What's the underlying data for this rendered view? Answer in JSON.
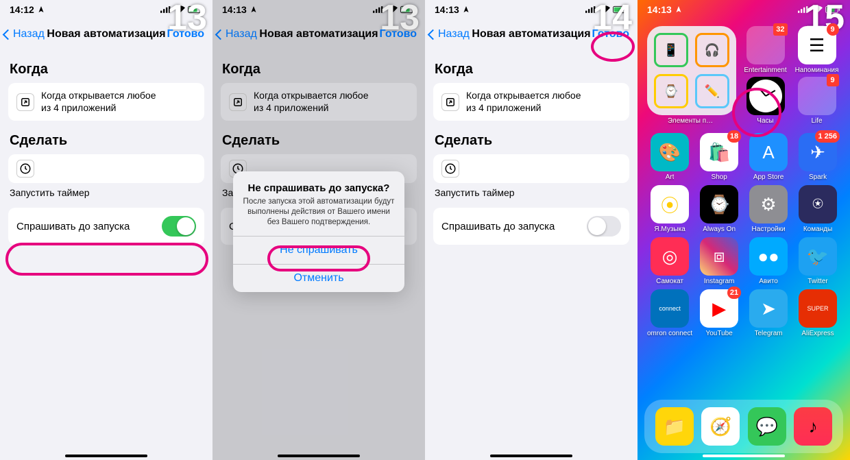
{
  "steps": [
    "13",
    "14",
    "15"
  ],
  "status": {
    "time": "14:12",
    "time_alt": "14:13"
  },
  "nav": {
    "back": "Назад",
    "title": "Новая автоматизация",
    "done": "Готово"
  },
  "when": {
    "header": "Когда",
    "card_line1": "Когда открывается любое",
    "card_line2": "из 4 приложений"
  },
  "do": {
    "header": "Сделать",
    "action": "Запустить таймер"
  },
  "toggle": {
    "label": "Спрашивать до запуска"
  },
  "alert": {
    "title": "Не спрашивать до запуска?",
    "msg": "После запуска этой автоматизации будут выполнены действия от Вашего имени без Вашего подтверждения.",
    "confirm": "Не спрашивать",
    "cancel": "Отменить"
  },
  "home": {
    "widget_label": "Элементы питания",
    "row1": [
      {
        "label": "Часы",
        "bg": "#000",
        "badge": "",
        "kind": "clock"
      },
      {
        "label": "Entertainment",
        "bg": "#folder",
        "badge": "32",
        "colors": [
          "#ff375f",
          "#e8455a",
          "#5856d6",
          "#ffcc00",
          "#007aff",
          "#5ac8fa",
          "#ff9500",
          "#34c759",
          "#af52de"
        ]
      },
      {
        "label": "Напоминания",
        "bg": "#fff",
        "badge": "9",
        "fg": "#000",
        "glyph": "☰"
      }
    ],
    "row2": [
      {
        "label": "Life",
        "bg": "#folder",
        "badge": "9",
        "colors": [
          "#ff708d",
          "#8e8e93",
          "#000",
          "#5ac8fa",
          "#ffcc00",
          "#007aff",
          "#34c759",
          "#ff9500",
          "#5856d6"
        ]
      }
    ],
    "grid": [
      {
        "label": "Art",
        "bg": "#00b9c6",
        "glyph": "🎨",
        "badge": ""
      },
      {
        "label": "Shop",
        "bg": "#ffffff",
        "glyph": "🛍️",
        "fg": "#333",
        "badge": "18"
      },
      {
        "label": "App Store",
        "bg": "#1e90ff",
        "glyph": "A",
        "badge": ""
      },
      {
        "label": "Spark",
        "bg": "#2a6df4",
        "glyph": "✈",
        "badge": "1 256"
      },
      {
        "label": "Я.Музыка",
        "bg": "#ffffff",
        "glyph": "⦿",
        "fg": "#ffcc00",
        "badge": ""
      },
      {
        "label": "Always On",
        "bg": "#000000",
        "glyph": "⌚",
        "badge": ""
      },
      {
        "label": "Настройки",
        "bg": "#8e8e93",
        "glyph": "⚙",
        "badge": ""
      },
      {
        "label": "Команды",
        "bg": "#2b2b5e",
        "glyph": "⍟",
        "badge": ""
      },
      {
        "label": "Самокат",
        "bg": "#ff2d55",
        "glyph": "◎",
        "badge": ""
      },
      {
        "label": "Instagram",
        "bg": "linear-gradient(45deg,#feda75,#d62976,#4f5bd5)",
        "glyph": "⧈",
        "badge": ""
      },
      {
        "label": "Авито",
        "bg": "#00aaff",
        "glyph": "●●",
        "badge": ""
      },
      {
        "label": "Twitter",
        "bg": "#1da1f2",
        "glyph": "🐦",
        "badge": ""
      },
      {
        "label": "omron connect",
        "bg": "#0071bc",
        "glyph": "connect",
        "fg": "#fff",
        "small": true,
        "badge": ""
      },
      {
        "label": "YouTube",
        "bg": "#ffffff",
        "glyph": "▶",
        "fg": "#ff0000",
        "badge": "21"
      },
      {
        "label": "Telegram",
        "bg": "#2aabee",
        "glyph": "➤",
        "badge": ""
      },
      {
        "label": "AliExpress",
        "bg": "#e62e04",
        "glyph": "SUPER",
        "small": true,
        "badge": ""
      }
    ],
    "dock": [
      {
        "bg": "#ffd60a",
        "glyph": "📁"
      },
      {
        "bg": "#ffffff",
        "glyph": "🧭",
        "fg": "#3478f6"
      },
      {
        "bg": "#34c759",
        "glyph": "💬"
      },
      {
        "bg": "linear-gradient(180deg,#fc3c44,#ff2d55)",
        "glyph": "♪"
      }
    ]
  }
}
